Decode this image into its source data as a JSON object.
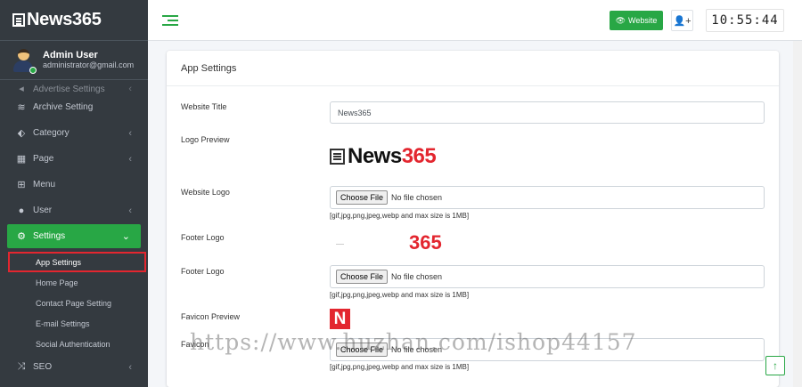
{
  "brand": {
    "name": "News365"
  },
  "user": {
    "name": "Admin User",
    "email": "administrator@gmail.com"
  },
  "sidebar": {
    "partial_item": "Advertise Settings",
    "items": [
      {
        "label": "Archive Setting",
        "icon": "waves-icon",
        "glyph": "≋"
      },
      {
        "label": "Category",
        "icon": "tag-icon",
        "glyph": "⬖"
      },
      {
        "label": "Page",
        "icon": "page-grid-icon",
        "glyph": "▦"
      },
      {
        "label": "Menu",
        "icon": "gift-icon",
        "glyph": "⊞"
      },
      {
        "label": "User",
        "icon": "user-icon",
        "glyph": "●"
      }
    ],
    "active": {
      "label": "Settings",
      "icon": "gear-icon",
      "glyph": "⚙"
    },
    "subitems": [
      "App Settings",
      "Home Page",
      "Contact Page Setting",
      "E-mail Settings",
      "Social Authentication"
    ],
    "seo": {
      "label": "SEO",
      "icon": "shuffle-icon",
      "glyph": "⤨"
    },
    "chevron_collapsed": "‹",
    "chevron_expanded": "⌄"
  },
  "header": {
    "website_label": "Website",
    "clock": "10:55:44"
  },
  "card": {
    "title": "App Settings",
    "website_title_label": "Website Title",
    "website_title_value": "News365",
    "logo_preview_label": "Logo Preview",
    "logo_preview": {
      "prefix": "News",
      "suffix": "365"
    },
    "website_logo_label": "Website Logo",
    "footer_logo_preview_label": "Footer Logo",
    "footer_logo_preview": "365",
    "footer_logo_label": "Footer Logo",
    "favicon_preview_label": "Favicon Preview",
    "favicon_glyph": "N",
    "favicon_label": "Favicon",
    "choose_file": "Choose File",
    "no_file": "No file chosen",
    "hint": "[gif,jpg,png,jpeg,webp and max size is 1MB]"
  },
  "watermark": "https://www.huzhan.com/ishop44157",
  "colors": {
    "accent": "#28a745",
    "brand_red": "#e3262f",
    "sidebar_bg": "#343a40"
  }
}
